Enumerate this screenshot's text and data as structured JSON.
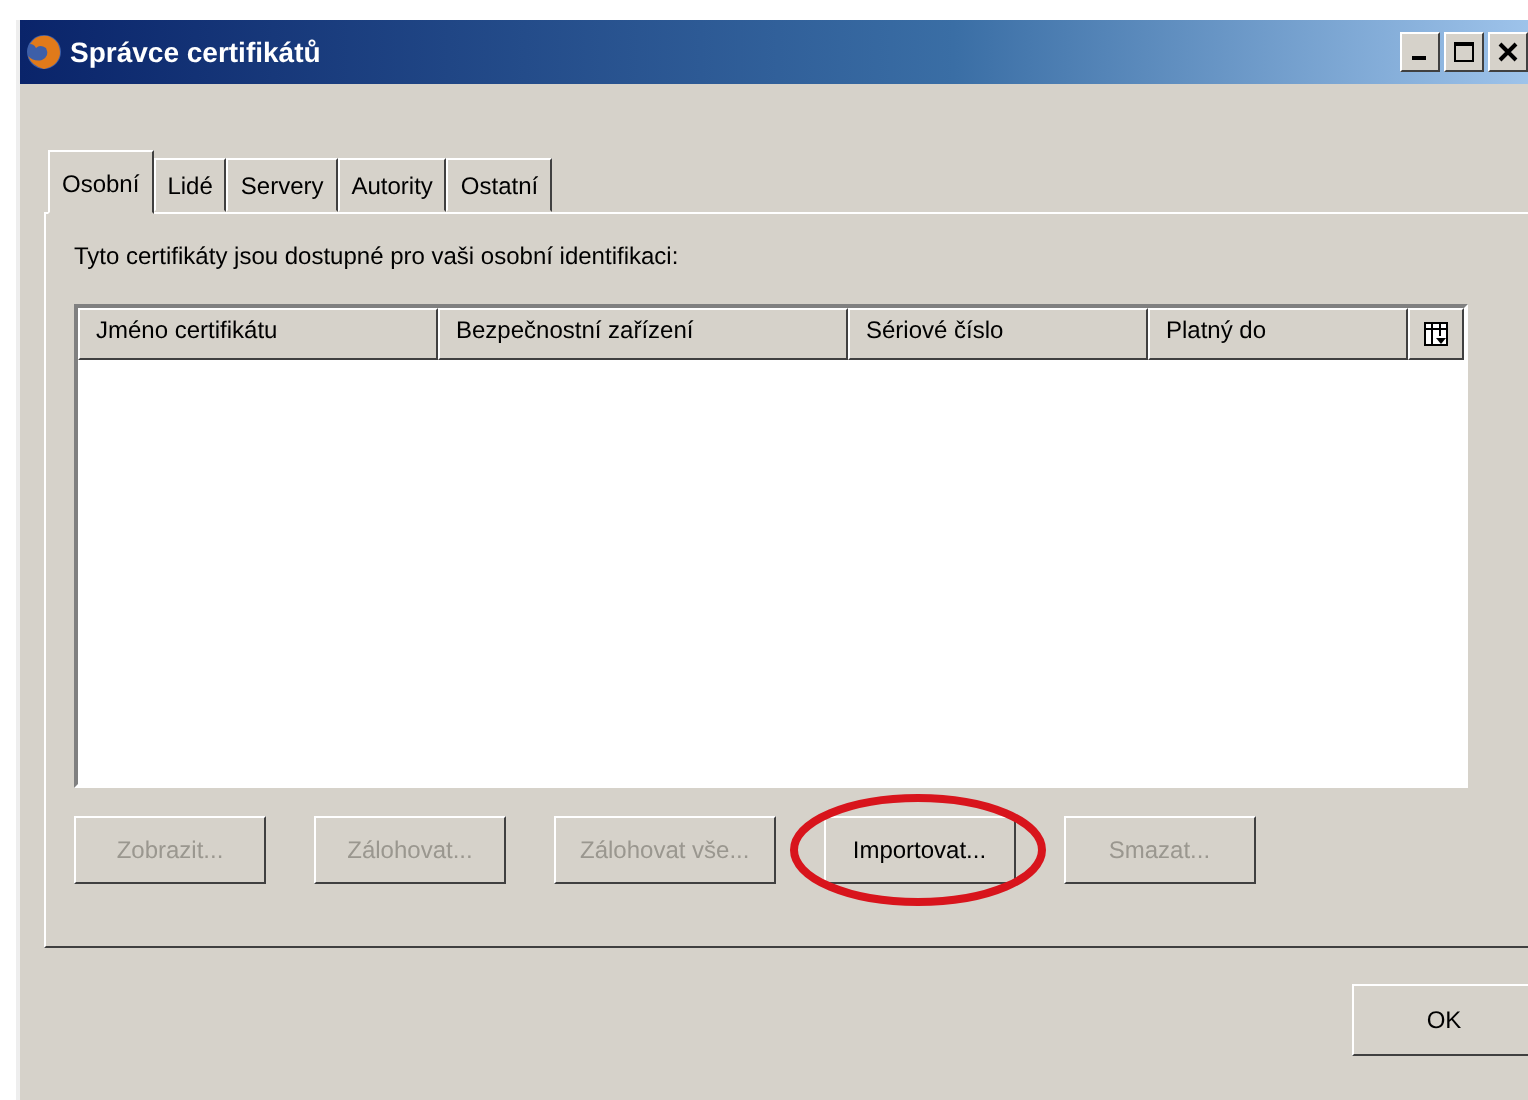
{
  "window": {
    "title": "Správce certifikátů"
  },
  "tabs": [
    {
      "label": "Osobní",
      "selected": true
    },
    {
      "label": "Lidé",
      "selected": false
    },
    {
      "label": "Servery",
      "selected": false
    },
    {
      "label": "Autority",
      "selected": false
    },
    {
      "label": "Ostatní",
      "selected": false
    }
  ],
  "description": "Tyto certifikáty jsou dostupné pro vaši osobní identifikaci:",
  "table": {
    "columns": [
      "Jméno certifikátu",
      "Bezpečnostní zařízení",
      "Sériové číslo",
      "Platný do"
    ]
  },
  "buttons": [
    {
      "label": "Zobrazit...",
      "disabled": true,
      "circled": false
    },
    {
      "label": "Zálohovat...",
      "disabled": true,
      "circled": false
    },
    {
      "label": "Zálohovat vše...",
      "disabled": true,
      "circled": false
    },
    {
      "label": "Importovat...",
      "disabled": false,
      "circled": true
    },
    {
      "label": "Smazat...",
      "disabled": true,
      "circled": false
    }
  ],
  "ok_button": "OK"
}
